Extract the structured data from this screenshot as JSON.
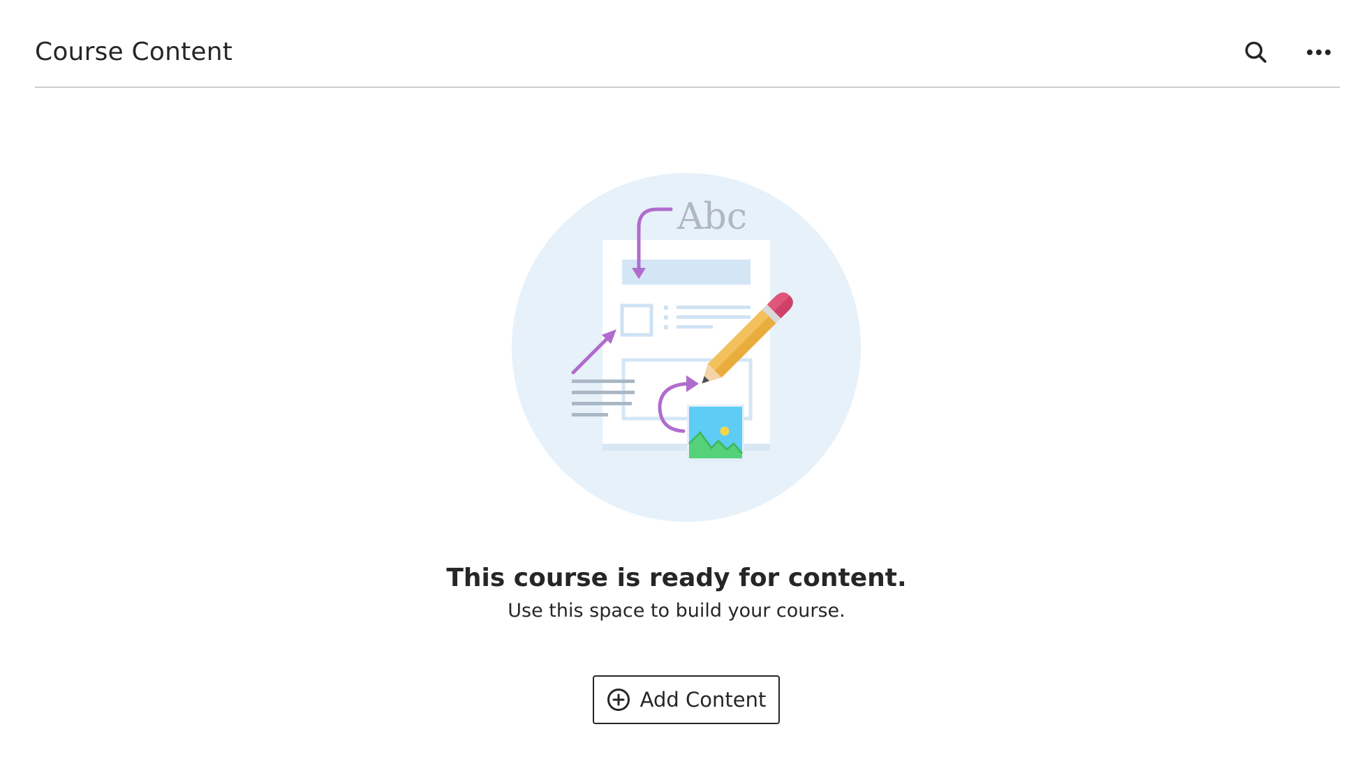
{
  "header": {
    "title": "Course Content",
    "search_icon": "search-icon",
    "more_icon": "more-options-icon"
  },
  "illustration": {
    "text": "Abc"
  },
  "empty_state": {
    "title": "This course is ready for content.",
    "subtitle": "Use this space to build your course."
  },
  "actions": {
    "add_content_label": "Add Content",
    "add_content_icon": "plus-circle-icon"
  },
  "colors": {
    "text": "#262626",
    "divider": "#cdcdcd",
    "circle_bg": "#e6f1fa",
    "accent_purple": "#b06ccd",
    "pencil_yellow": "#f2c15b",
    "eraser_pink": "#e0557a"
  }
}
